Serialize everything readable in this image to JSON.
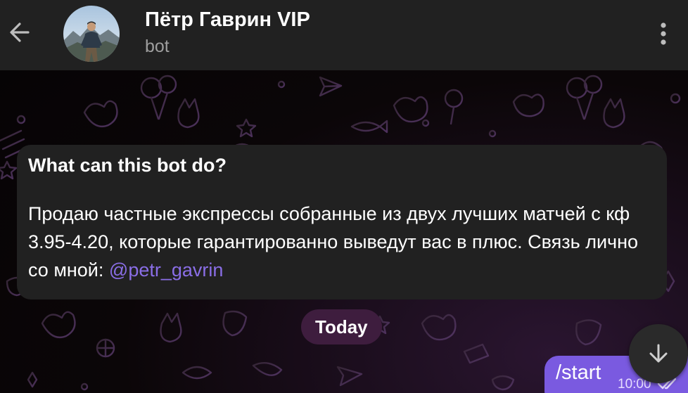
{
  "header": {
    "title": "Пётр Гаврин VIP",
    "subtitle": "bot",
    "back_icon": "arrow-left-icon",
    "menu_icon": "more-vertical-icon",
    "background": "#212121"
  },
  "bot_info": {
    "title": "What can this bot do?",
    "description": "Продаю частные экспрессы собранные из двух лучших матчей с кф 3.95-4.20, которые гарантированно выведут вас в плюс. Связь лично со мной: ",
    "mention": "@petr_gavrin",
    "mention_color": "#8a6ee6"
  },
  "date_chip": "Today",
  "messages": [
    {
      "direction": "outgoing",
      "text": "/start",
      "time": "10:00",
      "status_icon": "double-check-icon",
      "bubble_color": "#7a5ae0"
    }
  ],
  "scroll_down_icon": "arrow-down-icon"
}
